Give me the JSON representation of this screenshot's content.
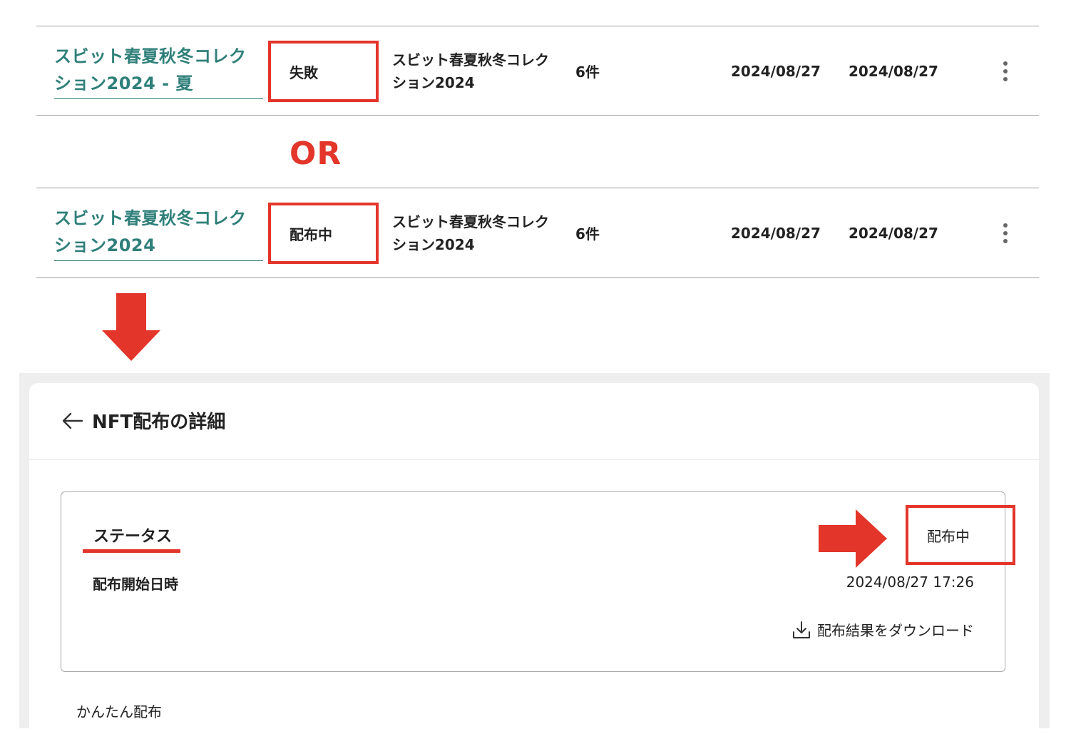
{
  "rows": [
    {
      "name_link": "スビット春夏秋冬コレクション2024 - 夏",
      "status": "失敗",
      "collection": "スビット春夏秋冬コレクション2024",
      "count": "6件",
      "date1": "2024/08/27",
      "date2": "2024/08/27"
    },
    {
      "name_link": "スビット春夏秋冬コレクション2024",
      "status": "配布中",
      "collection": "スビット春夏秋冬コレクション2024",
      "count": "6件",
      "date1": "2024/08/27",
      "date2": "2024/08/27"
    }
  ],
  "separator_text": "OR",
  "detail": {
    "title": "NFT配布の詳細",
    "status_label": "ステータス",
    "status_value": "配布中",
    "start_label": "配布開始日時",
    "start_value": "2024/08/27 17:26",
    "download_label": "配布結果をダウンロード",
    "easy_label": "かんたん配布"
  },
  "colors": {
    "annotation_red": "#e3352a",
    "link_teal": "#2f7f7a"
  },
  "icons": {
    "menu": "more-vert-icon",
    "back": "arrow-left-icon",
    "download": "download-icon"
  }
}
